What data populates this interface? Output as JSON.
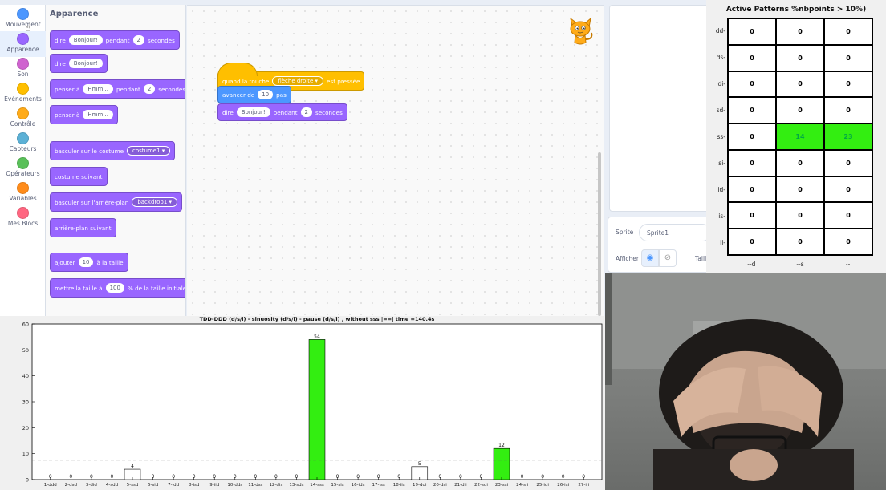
{
  "categories": [
    {
      "label": "Mouvement",
      "color": "#4c97ff",
      "selected": false
    },
    {
      "label": "Apparence",
      "color": "#9966ff",
      "selected": true
    },
    {
      "label": "Son",
      "color": "#cf63cf",
      "selected": false
    },
    {
      "label": "Événements",
      "color": "#ffbf00",
      "selected": false
    },
    {
      "label": "Contrôle",
      "color": "#ffab19",
      "selected": false
    },
    {
      "label": "Capteurs",
      "color": "#5cb1d6",
      "selected": false
    },
    {
      "label": "Opérateurs",
      "color": "#59c059",
      "selected": false
    },
    {
      "label": "Variables",
      "color": "#ff8c1a",
      "selected": false
    },
    {
      "label": "Mes Blocs",
      "color": "#ff6680",
      "selected": false
    }
  ],
  "palette": {
    "title": "Apparence",
    "blocks": [
      {
        "parts": [
          {
            "t": "text",
            "v": "dire"
          },
          {
            "t": "pill",
            "v": "Bonjour!"
          },
          {
            "t": "text",
            "v": "pendant"
          },
          {
            "t": "num",
            "v": "2"
          },
          {
            "t": "text",
            "v": "secondes"
          }
        ]
      },
      {
        "parts": [
          {
            "t": "text",
            "v": "dire"
          },
          {
            "t": "pill",
            "v": "Bonjour!"
          }
        ]
      },
      {
        "parts": [
          {
            "t": "text",
            "v": "penser à"
          },
          {
            "t": "pill",
            "v": "Hmm..."
          },
          {
            "t": "text",
            "v": "pendant"
          },
          {
            "t": "num",
            "v": "2"
          },
          {
            "t": "text",
            "v": "secondes"
          }
        ]
      },
      {
        "parts": [
          {
            "t": "text",
            "v": "penser à"
          },
          {
            "t": "pill",
            "v": "Hmm..."
          }
        ]
      },
      {
        "parts": [
          {
            "t": "text",
            "v": "basculer sur le costume"
          },
          {
            "t": "drop",
            "v": "costume1 ▾"
          }
        ]
      },
      {
        "parts": [
          {
            "t": "text",
            "v": "costume suivant"
          }
        ]
      },
      {
        "parts": [
          {
            "t": "text",
            "v": "basculer sur l'arrière-plan"
          },
          {
            "t": "drop",
            "v": "backdrop1 ▾"
          }
        ]
      },
      {
        "parts": [
          {
            "t": "text",
            "v": "arrière-plan suivant"
          }
        ]
      },
      {
        "parts": [
          {
            "t": "text",
            "v": "ajouter"
          },
          {
            "t": "num",
            "v": "10"
          },
          {
            "t": "text",
            "v": "à la taille"
          }
        ]
      },
      {
        "parts": [
          {
            "t": "text",
            "v": "mettre la taille à"
          },
          {
            "t": "num",
            "v": "100"
          },
          {
            "t": "text",
            "v": "% de la taille initiale"
          }
        ]
      }
    ]
  },
  "script": {
    "hat": {
      "before": "quand la touche",
      "key": "flèche droite ▾",
      "after": "est pressée"
    },
    "move": {
      "before": "avancer de",
      "value": "10",
      "after": "pas"
    },
    "say": {
      "before": "dire",
      "text": "Bonjour!",
      "mid": "pendant",
      "value": "2",
      "after": "secondes"
    }
  },
  "sprite_info": {
    "sprite_label": "Sprite",
    "sprite_name": "Sprite1",
    "show_label": "Afficher",
    "size_label": "Taille"
  },
  "heatmap": {
    "title": "Active Patterns %nbpoints > 10%)",
    "rows": [
      "dd-",
      "ds-",
      "di-",
      "sd-",
      "ss-",
      "si-",
      "id-",
      "is-",
      "ii-"
    ],
    "cols": [
      "--d",
      "--s",
      "--i"
    ],
    "values": [
      [
        0,
        0,
        0
      ],
      [
        0,
        0,
        0
      ],
      [
        0,
        0,
        0
      ],
      [
        0,
        0,
        0
      ],
      [
        0,
        14,
        23
      ],
      [
        0,
        0,
        0
      ],
      [
        0,
        0,
        0
      ],
      [
        0,
        0,
        0
      ],
      [
        0,
        0,
        0
      ]
    ],
    "highlight_color": "#33ee11"
  },
  "chart_data": {
    "type": "bar",
    "title": "TDD-DDD (d/s/i) - sinuosity (d/s/i) - pause (d/s/i) , without sss |==| time =140.4s",
    "categories": [
      "1-ddd",
      "2-dsd",
      "3-did",
      "4-sdd",
      "5-ssd",
      "6-sid",
      "7-idd",
      "8-isd",
      "9-iid",
      "10-dds",
      "11-dss",
      "12-dis",
      "13-sds",
      "14-sss",
      "15-sis",
      "16-ids",
      "17-iss",
      "18-iis",
      "19-ddi",
      "20-dsi",
      "21-dii",
      "22-sdi",
      "23-ssi",
      "24-sii",
      "25-idi",
      "26-isi",
      "27-iii"
    ],
    "values": [
      0,
      0,
      0,
      0,
      4,
      0,
      0,
      0,
      0,
      0,
      0,
      0,
      0,
      54,
      0,
      0,
      0,
      0,
      5,
      0,
      0,
      0,
      12,
      0,
      0,
      0,
      0
    ],
    "highlighted": [
      false,
      false,
      false,
      false,
      false,
      false,
      false,
      false,
      false,
      false,
      false,
      false,
      false,
      true,
      false,
      false,
      false,
      false,
      false,
      false,
      false,
      false,
      true,
      false,
      false,
      false,
      false
    ],
    "highlight_color": "#33ee11",
    "threshold": 7.5,
    "ylim": [
      0,
      60
    ],
    "yticks": [
      0,
      10,
      20,
      30,
      40,
      50,
      60
    ],
    "xlabel": "",
    "ylabel": ""
  }
}
